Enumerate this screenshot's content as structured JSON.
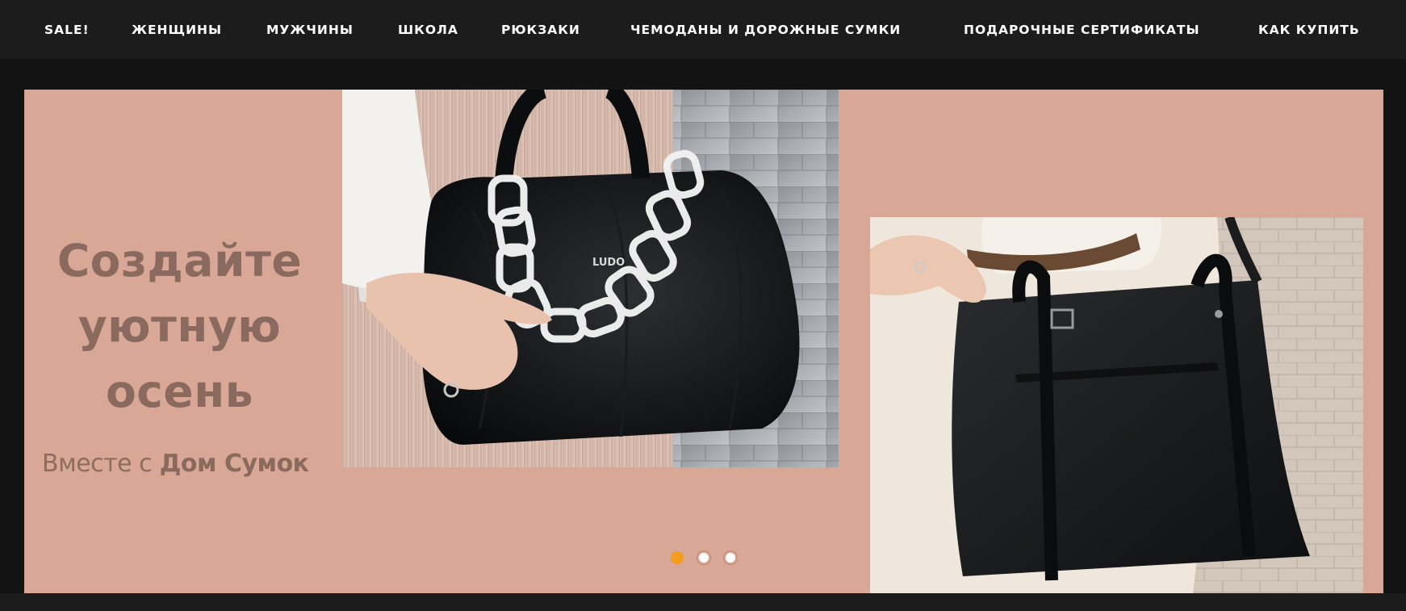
{
  "nav": {
    "items": [
      {
        "label": "SALE!"
      },
      {
        "label": "ЖЕНЩИНЫ"
      },
      {
        "label": "МУЖЧИНЫ"
      },
      {
        "label": "ШКОЛА"
      },
      {
        "label": "РЮКЗАКИ"
      },
      {
        "label": "ЧЕМОДАНЫ И ДОРОЖНЫЕ СУМКИ"
      },
      {
        "label": "ПОДАРОЧНЫЕ СЕРТИФИКАТЫ"
      },
      {
        "label": "КАК КУПИТЬ"
      }
    ]
  },
  "hero": {
    "title_line1": "Создайте",
    "title_line2": "уютную",
    "title_line3": "осень",
    "subtitle_light": "Вместе с",
    "subtitle_bold": "Дом Сумок",
    "brand_stamp": "LUDO",
    "active_slide": 1,
    "slide_count": 3
  },
  "colors": {
    "nav_bg": "#1c1c1c",
    "page_bg": "#131313",
    "hero_bg": "#d8a795",
    "hero_text": "#8a6a5e",
    "dot_active": "#f39c1d",
    "dot_inactive": "#ffffff"
  },
  "icons": {
    "slider_dot": "slider-dot-icon"
  }
}
